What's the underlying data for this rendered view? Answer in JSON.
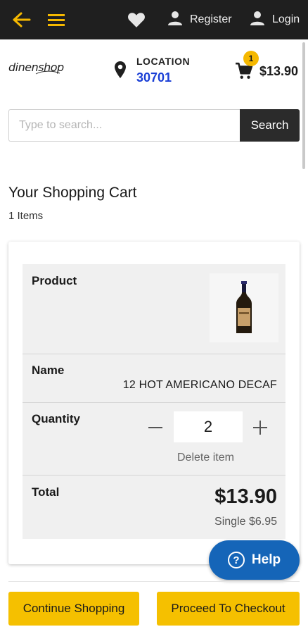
{
  "topbar": {
    "icons": [
      "back-arrow-icon",
      "menu-icon",
      "heart-icon",
      "person-icon",
      "person-icon"
    ],
    "register_label": "Register",
    "login_label": "Login",
    "accent_color": "#f5b800"
  },
  "header": {
    "logo_text": "dinenshop",
    "location_title": "LOCATION",
    "location_zip": "30701",
    "cart_badge": "1",
    "cart_total": "$13.90"
  },
  "search": {
    "placeholder": "Type to search...",
    "button_label": "Search"
  },
  "cart": {
    "title": "Your Shopping Cart",
    "count": "1 Items",
    "rows": {
      "product_label": "Product",
      "name_label": "Name",
      "name_value": "12 HOT AMERICANO DECAF",
      "quantity_label": "Quantity",
      "quantity_value": "2",
      "delete_label": "Delete item",
      "total_label": "Total",
      "total_value": "$13.90",
      "single_price": "Single $6.95"
    }
  },
  "help": {
    "label": "Help"
  },
  "footer": {
    "continue_label": "Continue Shopping",
    "checkout_label": "Proceed To Checkout"
  }
}
